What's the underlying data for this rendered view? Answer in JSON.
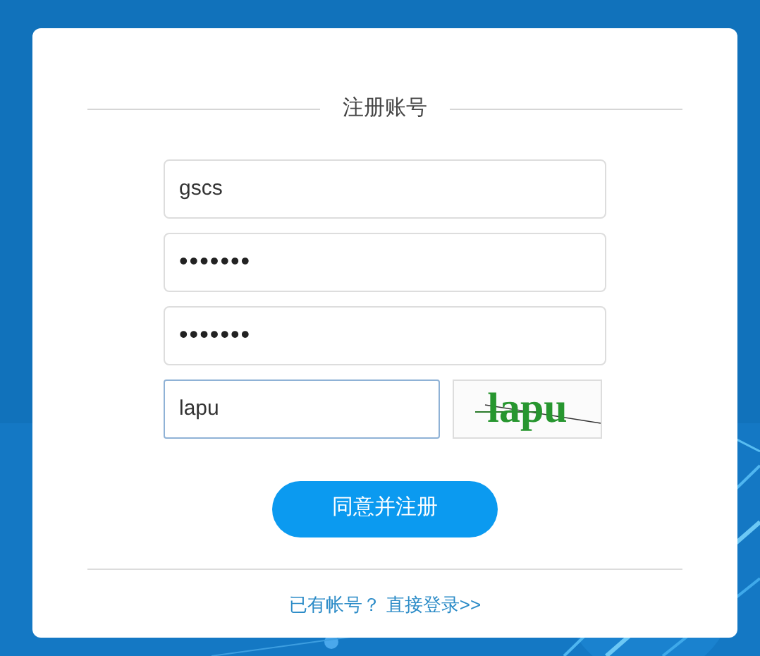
{
  "title": "注册账号",
  "fields": [
    {
      "kind": "text",
      "value": "gscs",
      "focused": false
    },
    {
      "kind": "password",
      "value": "•••••••",
      "focused": false
    },
    {
      "kind": "password",
      "value": "•••••••",
      "focused": false
    }
  ],
  "captcha": {
    "value": "lapu",
    "focused": true,
    "captcha_text": "lapu"
  },
  "submit_button": "同意并注册",
  "footer": {
    "prompt": "已有帐号？",
    "link": "直接登录>>"
  }
}
